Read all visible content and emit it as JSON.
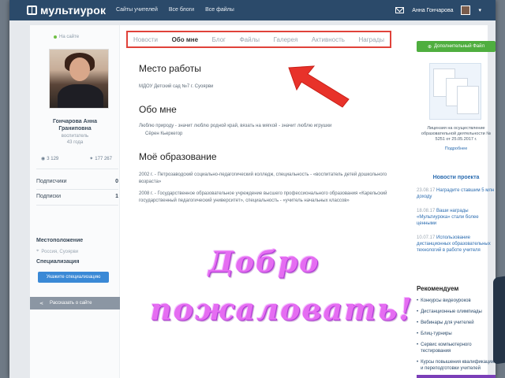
{
  "topbar": {
    "logo": "мультиурок",
    "nav": [
      "Сайты учителей",
      "Все блоги",
      "Все файлы"
    ],
    "user": "Анна Гончарова"
  },
  "profile": {
    "online": "На сайте",
    "name_line1": "Гончарова Анна",
    "name_line2": "Граниповна",
    "role": "воспитатель",
    "age": "43 года",
    "stat1": "3 129",
    "stat2": "177 267",
    "subscribers_label": "Подписчики",
    "subscribers_value": "0",
    "subscriptions_label": "Подписки",
    "subscriptions_value": "1",
    "location_title": "Местоположение",
    "location": "Россия, Суоярви",
    "specialization_title": "Специализация",
    "spec_button": "Укажите специализацию",
    "share": "Рассказать о сайте"
  },
  "tabs": [
    {
      "label": "Новости",
      "active": false
    },
    {
      "label": "Обо мне",
      "active": true
    },
    {
      "label": "Блог",
      "active": false
    },
    {
      "label": "Файлы",
      "active": false
    },
    {
      "label": "Галерея",
      "active": false
    },
    {
      "label": "Активность",
      "active": false
    },
    {
      "label": "Награды",
      "active": false
    }
  ],
  "main": {
    "workplace_title": "Место работы",
    "workplace": "МДОУ Детский сад №7 г. Суоярви",
    "about_title": "Обо мне",
    "about_text": "Люблю природу - значит люблю родной край, вязать на мягкой - значит люблю игрушки",
    "about_text2": "Сёрен Кьеркегор",
    "education_title": "Моё образование",
    "edu1": "2002 г. - Петрозаводский социально-педагогический колледж, специальность - «воспитатель детей дошкольного возраста»",
    "edu2": "2008 г. - Государственное образовательное учреждение высшего профессионального образования «Карельский государственный педагогический университет», специальность - «учитель начальных классов»",
    "welcome_line1": "Добро",
    "welcome_line2": "пожаловать!"
  },
  "right": {
    "add_button": "Дополнительный Файл",
    "cert_caption": "Лицензия на осуществление образовательной деятельности № 5251 от 25.05.2017 г.",
    "cert_link": "Подробнее",
    "news_title": "Новости проекта",
    "news": [
      {
        "date": "23.08.17",
        "text": "Наградите ставшим 5 млн доходу"
      },
      {
        "date": "18.08.17",
        "text": "Ваши награды «Мультиурока» стали более ценными"
      },
      {
        "date": "10.07.17",
        "text": "Использование дистанционных образовательных технологий в работе учителя"
      }
    ],
    "rec_title": "Рекомендуем",
    "recommendations": [
      "Конкурсы видеоуроков",
      "Дистанционные олимпиады",
      "Вебинары для учителей",
      "Блиц-турниры",
      "Сервис компьютерного тестирования",
      "Курсы повышения квалификации и переподготовки учителей"
    ]
  },
  "colors": {
    "topbar": "#2b4a6a",
    "highlight": "#e0423a",
    "welcome": "#e56df2",
    "green_button": "#4fae3f",
    "blue_button": "#3a89d6"
  }
}
